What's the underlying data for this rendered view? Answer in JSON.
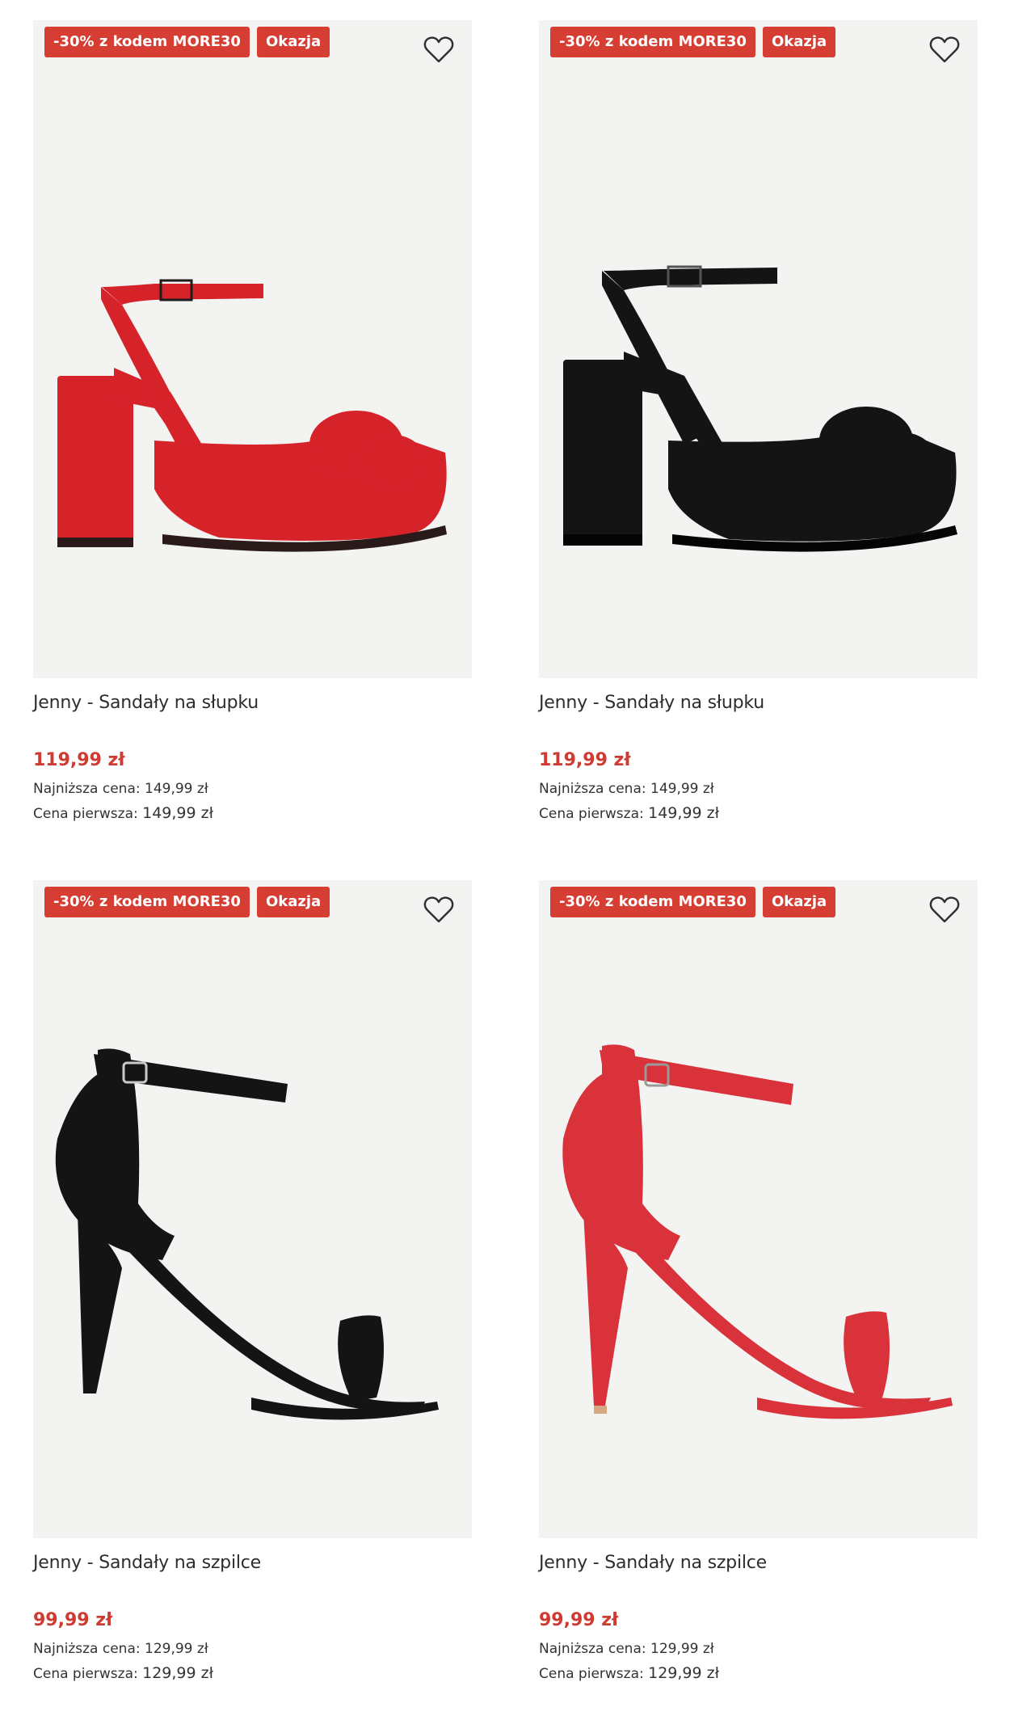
{
  "products": [
    {
      "badges": [
        "-30% z kodem MORE30",
        "Okazja"
      ],
      "name": "Jenny - Sandały na słupku",
      "price": "119,99 zł",
      "lowest_label": "Najniższa cena:",
      "lowest_value": "149,99 zł",
      "first_label": "Cena pierwsza:",
      "first_value": "149,99 zł",
      "color": "#d6232a"
    },
    {
      "badges": [
        "-30% z kodem MORE30",
        "Okazja"
      ],
      "name": "Jenny - Sandały na słupku",
      "price": "119,99 zł",
      "lowest_label": "Najniższa cena:",
      "lowest_value": "149,99 zł",
      "first_label": "Cena pierwsza:",
      "first_value": "149,99 zł",
      "color": "#141414"
    },
    {
      "badges": [
        "-30% z kodem MORE30",
        "Okazja"
      ],
      "name": "Jenny - Sandały na szpilce",
      "price": "99,99 zł",
      "lowest_label": "Najniższa cena:",
      "lowest_value": "129,99 zł",
      "first_label": "Cena pierwsza:",
      "first_value": "129,99 zł",
      "color": "#141414"
    },
    {
      "badges": [
        "-30% z kodem MORE30",
        "Okazja"
      ],
      "name": "Jenny - Sandały na szpilce",
      "price": "99,99 zł",
      "lowest_label": "Najniższa cena:",
      "lowest_value": "129,99 zł",
      "first_label": "Cena pierwsza:",
      "first_value": "129,99 zł",
      "color": "#d9323b"
    }
  ],
  "icons": {
    "favorite": "heart-outline-icon"
  },
  "colors": {
    "badge": "#d63d33",
    "price": "#cf3a31",
    "image_bg": "#f3f3f2"
  }
}
